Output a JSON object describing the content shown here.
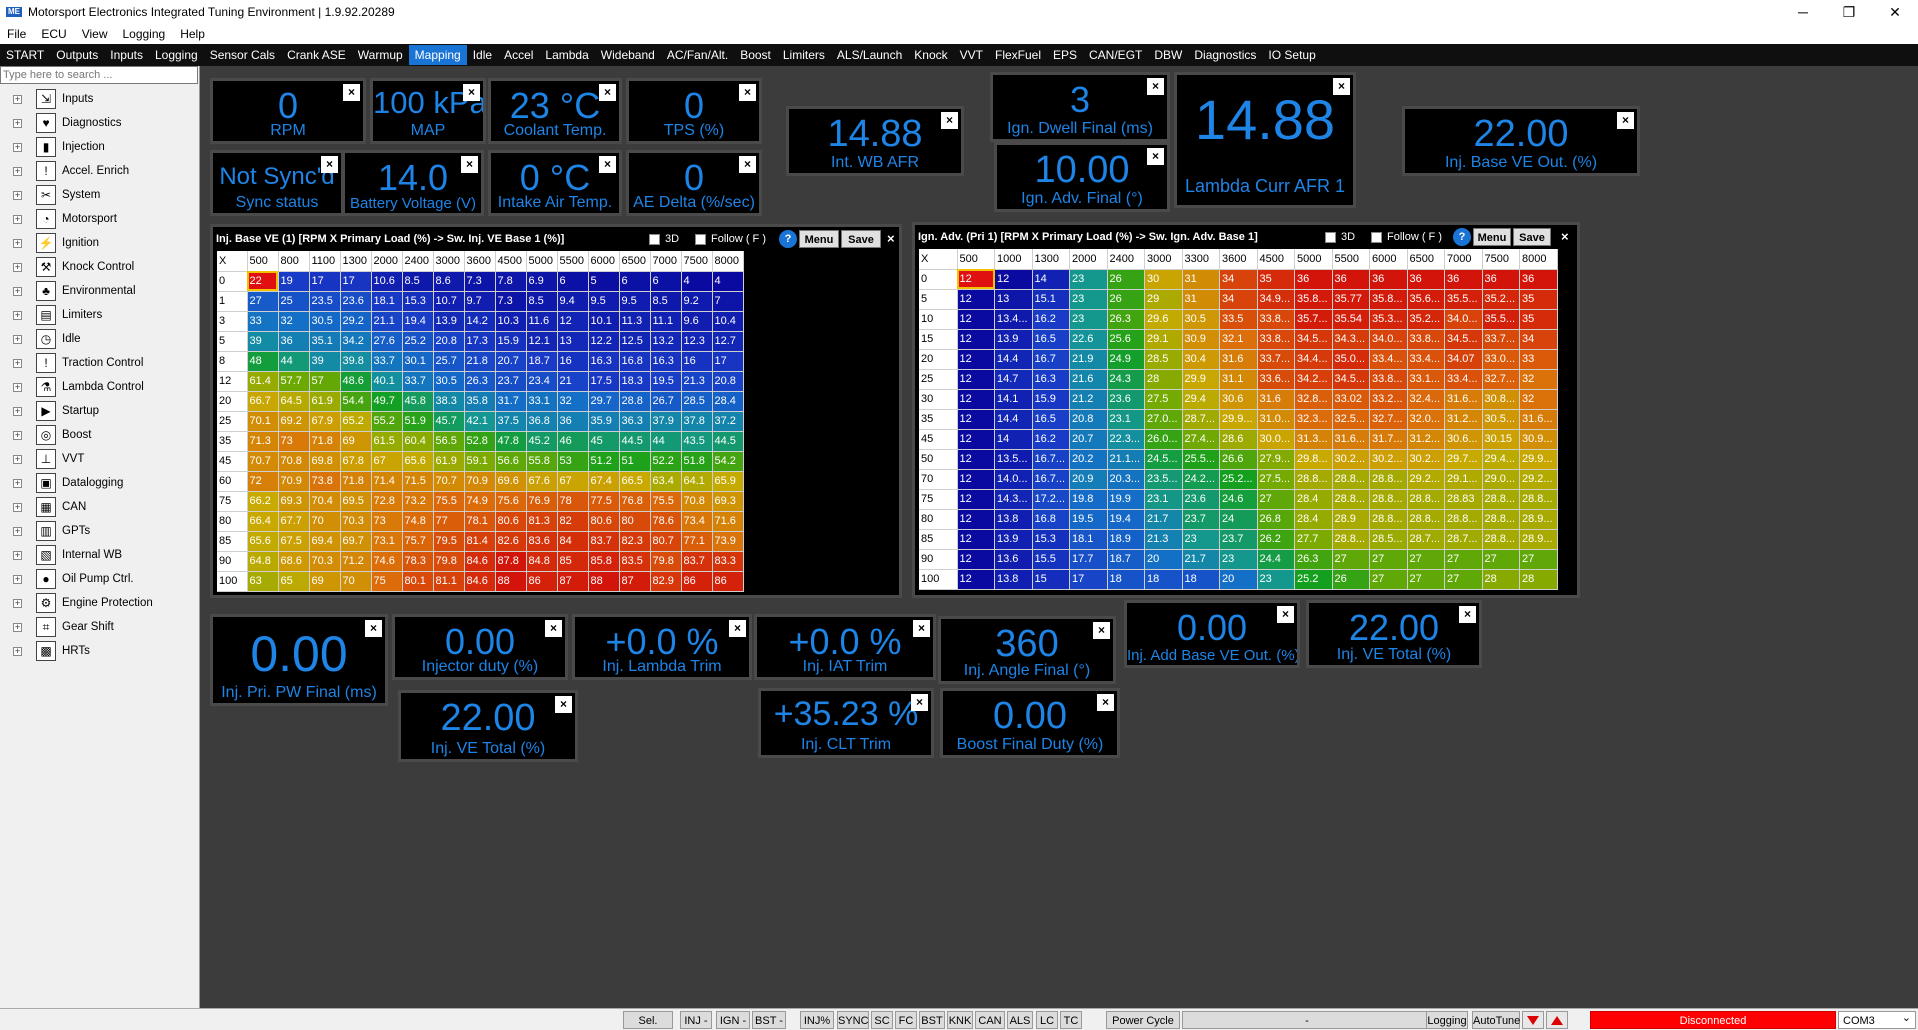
{
  "titlebar": {
    "title": "Motorsport Electronics Integrated Tuning Environment | 1.9.92.20289",
    "minimize": "─",
    "maximize": "❐",
    "close": "✕"
  },
  "menu": [
    "File",
    "ECU",
    "View",
    "Logging",
    "Help"
  ],
  "tabs": [
    "START",
    "Outputs",
    "Inputs",
    "Logging",
    "Sensor Cals",
    "Crank ASE",
    "Warmup",
    "Mapping",
    "Idle",
    "Accel",
    "Lambda",
    "Wideband",
    "AC/Fan/Alt.",
    "Boost",
    "Limiters",
    "ALS/Launch",
    "Knock",
    "VVT",
    "FlexFuel",
    "EPS",
    "CAN/EGT",
    "DBW",
    "Diagnostics",
    "IO Setup"
  ],
  "active_tab": "Mapping",
  "sidebar": {
    "search_placeholder": "Type here to search ...",
    "items": [
      {
        "label": "Inputs",
        "icon": "inputs-icon"
      },
      {
        "label": "Diagnostics",
        "icon": "heart-icon"
      },
      {
        "label": "Injection",
        "icon": "injector-icon"
      },
      {
        "label": "Accel. Enrich",
        "icon": "exclamation-icon"
      },
      {
        "label": "System",
        "icon": "tools-icon"
      },
      {
        "label": "Motorsport",
        "icon": "speedometer-icon"
      },
      {
        "label": "Ignition",
        "icon": "spark-icon"
      },
      {
        "label": "Knock Control",
        "icon": "hammer-icon"
      },
      {
        "label": "Environmental",
        "icon": "tree-icon"
      },
      {
        "label": "Limiters",
        "icon": "limiter-icon"
      },
      {
        "label": "Idle",
        "icon": "clock-icon"
      },
      {
        "label": "Traction Control",
        "icon": "exclamation-icon"
      },
      {
        "label": "Lambda Control",
        "icon": "flask-icon"
      },
      {
        "label": "Startup",
        "icon": "startup-icon"
      },
      {
        "label": "Boost",
        "icon": "turbo-icon"
      },
      {
        "label": "VVT",
        "icon": "camshaft-icon"
      },
      {
        "label": "Datalogging",
        "icon": "disk-icon"
      },
      {
        "label": "CAN",
        "icon": "can-icon"
      },
      {
        "label": "GPTs",
        "icon": "gpt-icon"
      },
      {
        "label": "Internal WB",
        "icon": "wideband-icon"
      },
      {
        "label": "Oil Pump Ctrl.",
        "icon": "oil-icon"
      },
      {
        "label": "Engine Protection",
        "icon": "engine-icon"
      },
      {
        "label": "Gear Shift",
        "icon": "gearshift-icon"
      },
      {
        "label": "HRTs",
        "icon": "hrt-icon"
      }
    ]
  },
  "gauges": {
    "rpm": {
      "value": "0",
      "label": "RPM"
    },
    "map": {
      "value": "100 kPa",
      "label": "MAP"
    },
    "coolant": {
      "value": "23 °C",
      "label": "Coolant Temp."
    },
    "tps": {
      "value": "0",
      "label": "TPS (%)"
    },
    "sync": {
      "value": "Not Sync'd",
      "label": "Sync status"
    },
    "battery": {
      "value": "14.0",
      "label": "Battery Voltage (V)"
    },
    "iat": {
      "value": "0 °C",
      "label": "Intake Air Temp."
    },
    "ae": {
      "value": "0",
      "label": "AE Delta (%/sec)"
    },
    "wbafr": {
      "value": "14.88",
      "label": "Int. WB AFR"
    },
    "dwell": {
      "value": "3",
      "label": "Ign. Dwell Final (ms)"
    },
    "advfinal": {
      "value": "10.00",
      "label": "Ign. Adv. Final (°)"
    },
    "lambdaafr": {
      "value": "14.88",
      "label": "Lambda Curr AFR 1"
    },
    "basevebig": {
      "value": "22.00",
      "label": "Inj. Base VE Out. (%)"
    },
    "pripw": {
      "value": "0.00",
      "label": "Inj. Pri. PW Final (ms)"
    },
    "duty": {
      "value": "0.00",
      "label": "Injector duty (%)"
    },
    "lambdatrim": {
      "value": "+0.0 %",
      "label": "Inj. Lambda Trim"
    },
    "iattrim": {
      "value": "+0.0 %",
      "label": "Inj. IAT Trim"
    },
    "angle": {
      "value": "360",
      "label": "Inj. Angle Final (°)"
    },
    "addbase": {
      "value": "0.00",
      "label": "Inj. Add Base VE Out. (%)"
    },
    "vetotal1": {
      "value": "22.00",
      "label": "Inj. VE Total (%)"
    },
    "vetotal2": {
      "value": "22.00",
      "label": "Inj. VE Total (%)"
    },
    "clttrim": {
      "value": "+35.23 %",
      "label": "Inj. CLT Trim"
    },
    "boost": {
      "value": "0.00",
      "label": "Boost Final Duty (%)"
    }
  },
  "close_glyph": "×",
  "ve_table": {
    "title": "Inj. Base VE (1) [RPM X Primary Load (%) -> Sw. Inj. VE Base 1 (%)]",
    "opt_3d": "3D",
    "opt_follow": "Follow ( F )",
    "help": "?",
    "menu": "Menu",
    "save": "Save",
    "close": "×",
    "corner": "X",
    "cols": [
      "500",
      "800",
      "1100",
      "1300",
      "2000",
      "2400",
      "3000",
      "3600",
      "4500",
      "5000",
      "5500",
      "6000",
      "6500",
      "7000",
      "7500",
      "8000"
    ],
    "rows": [
      {
        "load": "0",
        "v": [
          "22",
          "19",
          "17",
          "17",
          "10.6",
          "8.5",
          "8.6",
          "7.3",
          "7.8",
          "6.9",
          "6",
          "5",
          "6",
          "6",
          "4",
          "4"
        ]
      },
      {
        "load": "1",
        "v": [
          "27",
          "25",
          "23.5",
          "23.6",
          "18.1",
          "15.3",
          "10.7",
          "9.7",
          "7.3",
          "8.5",
          "9.4",
          "9.5",
          "9.5",
          "8.5",
          "9.2",
          "7"
        ]
      },
      {
        "load": "3",
        "v": [
          "33",
          "32",
          "30.5",
          "29.2",
          "21.1",
          "19.4",
          "13.9",
          "14.2",
          "10.3",
          "11.6",
          "12",
          "10.1",
          "11.3",
          "11.1",
          "9.6",
          "10.4"
        ]
      },
      {
        "load": "5",
        "v": [
          "39",
          "36",
          "35.1",
          "34.2",
          "27.6",
          "25.2",
          "20.8",
          "17.3",
          "15.9",
          "12.1",
          "13",
          "12.2",
          "12.5",
          "13.2",
          "12.3",
          "12.7"
        ]
      },
      {
        "load": "8",
        "v": [
          "48",
          "44",
          "39",
          "39.8",
          "33.7",
          "30.1",
          "25.7",
          "21.8",
          "20.7",
          "18.7",
          "16",
          "16.3",
          "16.8",
          "16.3",
          "16",
          "17"
        ]
      },
      {
        "load": "12",
        "v": [
          "61.4",
          "57.7",
          "57",
          "48.6",
          "40.1",
          "33.7",
          "30.5",
          "26.3",
          "23.7",
          "23.4",
          "21",
          "17.5",
          "18.3",
          "19.5",
          "21.3",
          "20.8"
        ]
      },
      {
        "load": "20",
        "v": [
          "66.7",
          "64.5",
          "61.9",
          "54.4",
          "49.7",
          "45.8",
          "38.3",
          "35.8",
          "31.7",
          "33.1",
          "32",
          "29.7",
          "28.8",
          "26.7",
          "28.5",
          "28.4"
        ]
      },
      {
        "load": "25",
        "v": [
          "70.1",
          "69.2",
          "67.9",
          "65.2",
          "55.2",
          "51.9",
          "45.7",
          "42.1",
          "37.5",
          "36.8",
          "36",
          "35.9",
          "36.3",
          "37.9",
          "37.8",
          "37.2"
        ]
      },
      {
        "load": "35",
        "v": [
          "71.3",
          "73",
          "71.8",
          "69",
          "61.5",
          "60.4",
          "56.5",
          "52.8",
          "47.8",
          "45.2",
          "46",
          "45",
          "44.5",
          "44",
          "43.5",
          "44.5"
        ]
      },
      {
        "load": "45",
        "v": [
          "70.7",
          "70.8",
          "69.8",
          "67.8",
          "67",
          "65.6",
          "61.9",
          "59.1",
          "56.6",
          "55.8",
          "53",
          "51.2",
          "51",
          "52.2",
          "51.8",
          "54.2"
        ]
      },
      {
        "load": "60",
        "v": [
          "72",
          "70.9",
          "73.8",
          "71.8",
          "71.4",
          "71.5",
          "70.7",
          "70.9",
          "69.6",
          "67.6",
          "67",
          "67.4",
          "66.5",
          "63.4",
          "64.1",
          "65.9"
        ]
      },
      {
        "load": "75",
        "v": [
          "66.2",
          "69.3",
          "70.4",
          "69.5",
          "72.8",
          "73.2",
          "75.5",
          "74.9",
          "75.6",
          "76.9",
          "78",
          "77.5",
          "76.8",
          "75.5",
          "70.8",
          "69.3"
        ]
      },
      {
        "load": "80",
        "v": [
          "66.4",
          "67.7",
          "70",
          "70.3",
          "73",
          "74.8",
          "77",
          "78.1",
          "80.6",
          "81.3",
          "82",
          "80.6",
          "80",
          "78.6",
          "73.4",
          "71.6"
        ]
      },
      {
        "load": "85",
        "v": [
          "65.6",
          "67.5",
          "69.4",
          "69.7",
          "73.1",
          "75.7",
          "79.5",
          "81.4",
          "82.6",
          "83.6",
          "84",
          "83.7",
          "82.3",
          "80.7",
          "77.1",
          "73.9"
        ]
      },
      {
        "load": "90",
        "v": [
          "64.8",
          "68.6",
          "70.3",
          "71.2",
          "74.6",
          "78.3",
          "79.8",
          "84.6",
          "87.8",
          "84.8",
          "85",
          "85.8",
          "83.5",
          "79.8",
          "83.7",
          "83.3"
        ]
      },
      {
        "load": "100",
        "v": [
          "63",
          "65",
          "69",
          "70",
          "75",
          "80.1",
          "81.1",
          "84.6",
          "88",
          "86",
          "87",
          "88",
          "87",
          "82.9",
          "86",
          "86"
        ]
      }
    ]
  },
  "ign_table": {
    "title": "Ign. Adv. (Pri 1) [RPM X Primary Load (%) -> Sw. Ign. Adv. Base 1]",
    "opt_3d": "3D",
    "opt_follow": "Follow ( F )",
    "help": "?",
    "menu": "Menu",
    "save": "Save",
    "close": "×",
    "corner": "X",
    "cols": [
      "500",
      "1000",
      "1300",
      "2000",
      "2400",
      "3000",
      "3300",
      "3600",
      "4500",
      "5000",
      "5500",
      "6000",
      "6500",
      "7000",
      "7500",
      "8000"
    ],
    "rows": [
      {
        "load": "0",
        "v": [
          "12",
          "12",
          "14",
          "23",
          "26",
          "30",
          "31",
          "34",
          "35",
          "36",
          "36",
          "36",
          "36",
          "36",
          "36",
          "36"
        ]
      },
      {
        "load": "5",
        "v": [
          "12",
          "13",
          "15.1",
          "23",
          "26",
          "29",
          "31",
          "34",
          "34.9...",
          "35.8...",
          "35.77",
          "35.8...",
          "35.6...",
          "35.5...",
          "35.2...",
          "35"
        ]
      },
      {
        "load": "10",
        "v": [
          "12",
          "13.4...",
          "16.2",
          "23",
          "26.3",
          "29.6",
          "30.5",
          "33.5",
          "33.8...",
          "35.7...",
          "35.54",
          "35.3...",
          "35.2...",
          "34.0...",
          "35.5...",
          "35"
        ]
      },
      {
        "load": "15",
        "v": [
          "12",
          "13.9",
          "16.5",
          "22.6",
          "25.6",
          "29.1",
          "30.9",
          "32.1",
          "33.8...",
          "34.5...",
          "34.3...",
          "34.0...",
          "33.8...",
          "34.5...",
          "33.7...",
          "34"
        ]
      },
      {
        "load": "20",
        "v": [
          "12",
          "14.4",
          "16.7",
          "21.9",
          "24.9",
          "28.5",
          "30.4",
          "31.6",
          "33.7...",
          "34.4...",
          "35.0...",
          "33.4...",
          "33.4...",
          "34.07",
          "33.0...",
          "33"
        ]
      },
      {
        "load": "25",
        "v": [
          "12",
          "14.7",
          "16.3",
          "21.6",
          "24.3",
          "28",
          "29.9",
          "31.1",
          "33.6...",
          "34.2...",
          "34.5...",
          "33.8...",
          "33.1...",
          "33.4...",
          "32.7...",
          "32"
        ]
      },
      {
        "load": "30",
        "v": [
          "12",
          "14.1",
          "15.9",
          "21.2",
          "23.6",
          "27.5",
          "29.4",
          "30.6",
          "31.6",
          "32.8...",
          "33.02",
          "33.2...",
          "32.4...",
          "31.6...",
          "30.8...",
          "32"
        ]
      },
      {
        "load": "35",
        "v": [
          "12",
          "14.4",
          "16.5",
          "20.8",
          "23.1",
          "27.0...",
          "28.7...",
          "29.9...",
          "31.0...",
          "32.3...",
          "32.5...",
          "32.7...",
          "32.0...",
          "31.2...",
          "30.5...",
          "31.6..."
        ]
      },
      {
        "load": "45",
        "v": [
          "12",
          "14",
          "16.2",
          "20.7",
          "22.3...",
          "26.0...",
          "27.4...",
          "28.6",
          "30.0...",
          "31.3...",
          "31.6...",
          "31.7...",
          "31.2...",
          "30.6...",
          "30.15",
          "30.9..."
        ]
      },
      {
        "load": "50",
        "v": [
          "12",
          "13.5...",
          "16.7...",
          "20.2",
          "21.1...",
          "24.5...",
          "25.5...",
          "26.6",
          "27.9...",
          "29.8...",
          "30.2...",
          "30.2...",
          "30.2...",
          "29.7...",
          "29.4...",
          "29.9..."
        ]
      },
      {
        "load": "70",
        "v": [
          "12",
          "14.0...",
          "16.7...",
          "20.9",
          "20.3...",
          "23.5...",
          "24.2...",
          "25.2...",
          "27.5...",
          "28.8...",
          "28.8...",
          "28.8...",
          "29.2...",
          "29.1...",
          "29.0...",
          "29.2..."
        ]
      },
      {
        "load": "75",
        "v": [
          "12",
          "14.3...",
          "17.2...",
          "19.8",
          "19.9",
          "23.1",
          "23.6",
          "24.6",
          "27",
          "28.4",
          "28.8...",
          "28.8...",
          "28.8...",
          "28.83",
          "28.8...",
          "28.8..."
        ]
      },
      {
        "load": "80",
        "v": [
          "12",
          "13.8",
          "16.8",
          "19.5",
          "19.4",
          "21.7",
          "23.7",
          "24",
          "26.8",
          "28.4",
          "28.9",
          "28.8...",
          "28.8...",
          "28.8...",
          "28.8...",
          "28.9..."
        ]
      },
      {
        "load": "85",
        "v": [
          "12",
          "13.9",
          "15.3",
          "18.1",
          "18.9",
          "21.3",
          "23",
          "23.7",
          "26.2",
          "27.7",
          "28.8...",
          "28.5...",
          "28.7...",
          "28.7...",
          "28.8...",
          "28.9..."
        ]
      },
      {
        "load": "90",
        "v": [
          "12",
          "13.6",
          "15.5",
          "17.7",
          "18.7",
          "20",
          "21.7",
          "23",
          "24.4",
          "26.3",
          "27",
          "27",
          "27",
          "27",
          "27",
          "27"
        ]
      },
      {
        "load": "100",
        "v": [
          "12",
          "13.8",
          "15",
          "17",
          "18",
          "18",
          "18",
          "20",
          "23",
          "25.2",
          "26",
          "27",
          "27",
          "27",
          "28",
          "28"
        ]
      }
    ]
  },
  "statusbar": {
    "items": [
      "Sel. Map.:",
      "INJ -",
      "IGN -",
      "BST -",
      "INJ%",
      "SYNC",
      "SC",
      "FC",
      "BST",
      "KNK",
      "CAN",
      "ALS",
      "LC",
      "TC",
      "Power Cycle",
      "-",
      "Logging",
      "AutoTune"
    ],
    "connection": "Disconnected",
    "port": "COM3",
    "colors": {
      "disconnected": "#ff0000",
      "accent": "#1e84e6"
    }
  }
}
